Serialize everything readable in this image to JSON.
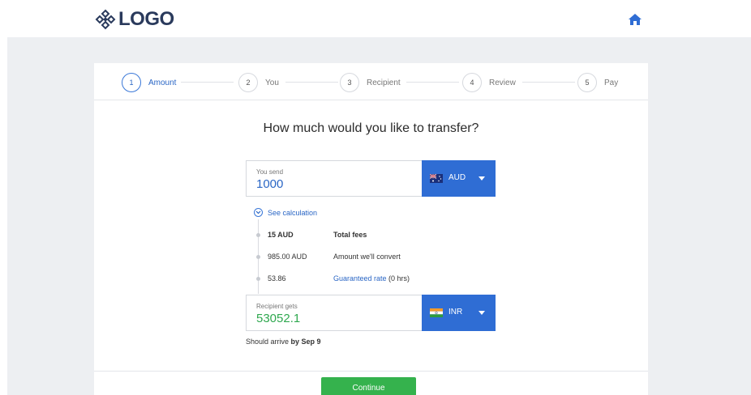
{
  "header": {
    "logo_text": "LOGO",
    "brand_color": "#2a3a5c",
    "home_icon": "home-icon"
  },
  "steps": [
    {
      "number": "1",
      "label": "Amount",
      "active": true
    },
    {
      "number": "2",
      "label": "You",
      "active": false
    },
    {
      "number": "3",
      "label": "Recipient",
      "active": false
    },
    {
      "number": "4",
      "label": "Review",
      "active": false
    },
    {
      "number": "5",
      "label": "Pay",
      "active": false
    }
  ],
  "main": {
    "question": "How much would you like to transfer?",
    "send": {
      "label": "You send",
      "value": "1000",
      "currency": "AUD",
      "flag_icon": "australia-flag-icon"
    },
    "calculation": {
      "toggle_label": "See calculation",
      "fees_amount": "15 AUD",
      "fees_label": "Total fees",
      "convert_amount": "985.00 AUD",
      "convert_label": "Amount we'll convert",
      "rate_value": "53.86",
      "rate_link": "Guaranteed rate",
      "rate_suffix": " (0 hrs)"
    },
    "receive": {
      "label": "Recipient gets",
      "value": "53052.1",
      "currency": "INR",
      "flag_icon": "india-flag-icon"
    },
    "arrival_prefix": "Should arrive ",
    "arrival_date": "by Sep 9",
    "continue_label": "Continue"
  },
  "colors": {
    "accent": "#2f6dd4",
    "success": "#35b24d",
    "background": "#edeff2"
  }
}
